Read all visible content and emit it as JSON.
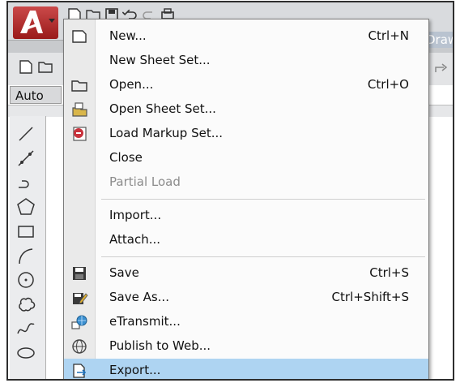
{
  "ribbon": {
    "tab_partial": "Draw",
    "workspace_partial": "Auto"
  },
  "menu": {
    "items": [
      {
        "label": "New...",
        "shortcut": "Ctrl+N",
        "icon": "new-file-icon"
      },
      {
        "label": "New Sheet Set...",
        "shortcut": "",
        "icon": ""
      },
      {
        "label": "Open...",
        "shortcut": "Ctrl+O",
        "icon": "open-folder-icon"
      },
      {
        "label": "Open Sheet Set...",
        "shortcut": "",
        "icon": "open-sheet-set-icon"
      },
      {
        "label": "Load Markup Set...",
        "shortcut": "",
        "icon": "load-markup-icon"
      },
      {
        "label": "Close",
        "shortcut": "",
        "icon": ""
      },
      {
        "label": "Partial Load",
        "shortcut": "",
        "icon": "",
        "disabled": true
      },
      {
        "label": "Import...",
        "shortcut": "",
        "icon": ""
      },
      {
        "label": "Attach...",
        "shortcut": "",
        "icon": ""
      },
      {
        "label": "Save",
        "shortcut": "Ctrl+S",
        "icon": "save-icon"
      },
      {
        "label": "Save As...",
        "shortcut": "Ctrl+Shift+S",
        "icon": "save-as-icon"
      },
      {
        "label": "eTransmit...",
        "shortcut": "",
        "icon": "etransmit-icon"
      },
      {
        "label": "Publish to Web...",
        "shortcut": "",
        "icon": "publish-web-icon"
      },
      {
        "label": "Export...",
        "shortcut": "",
        "icon": "export-icon",
        "highlighted": true
      }
    ]
  },
  "colors": {
    "menu_highlight": "#aed4f2",
    "app_button": "#b02a2a",
    "disabled_text": "#8c8c8c"
  }
}
